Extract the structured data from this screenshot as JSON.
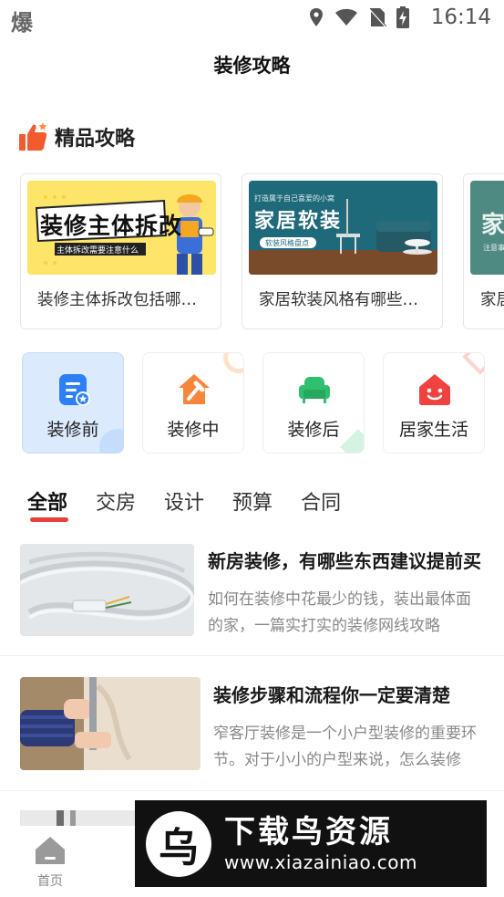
{
  "status_bar": {
    "app_glyph": "爆",
    "time": "16:14"
  },
  "header": {
    "title": "装修攻略"
  },
  "featured_section": {
    "title": "精品攻略"
  },
  "featured_cards": [
    {
      "image_title": "装修主体拆改",
      "image_subtitle": "主体拆改需要注意什么",
      "caption": "装修主体拆改包括哪些内容"
    },
    {
      "image_small": "打造属于自己喜爱的小窝",
      "image_title": "家居软装",
      "image_tag": "软装风格盘点",
      "caption": "家居软装风格有哪些类型"
    },
    {
      "image_title": "家居",
      "image_small": "注意事",
      "caption": "家居"
    }
  ],
  "categories": [
    {
      "label": "装修前",
      "icon": "clipboard-icon",
      "active": true,
      "color": "#2d7ff6"
    },
    {
      "label": "装修中",
      "icon": "house-hammer-icon",
      "active": false,
      "color": "#f7863a"
    },
    {
      "label": "装修后",
      "icon": "sofa-icon",
      "active": false,
      "color": "#2fbf6e"
    },
    {
      "label": "居家生活",
      "icon": "smiling-house-icon",
      "active": false,
      "color": "#f0433f"
    }
  ],
  "tabs": [
    "全部",
    "交房",
    "设计",
    "预算",
    "合同"
  ],
  "active_tab": "全部",
  "articles": [
    {
      "title": "新房装修，有哪些东西建议提前买",
      "desc": "如何在装修中花最少的钱，装出最体面的家，一篇实打实的装修网线攻略"
    },
    {
      "title": "装修步骤和流程你一定要清楚",
      "desc": "窄客厅装修是一个小户型装修的重要环节。对于小小的户型来说，怎么装修"
    }
  ],
  "bottom_nav": {
    "home_label": "首页"
  },
  "watermark": {
    "logo_char": "乌",
    "title": "下载鸟资源",
    "url": "www.xiazainiao.com"
  },
  "colors": {
    "accent_red": "#e8403e",
    "active_bg": "#dceafd"
  }
}
